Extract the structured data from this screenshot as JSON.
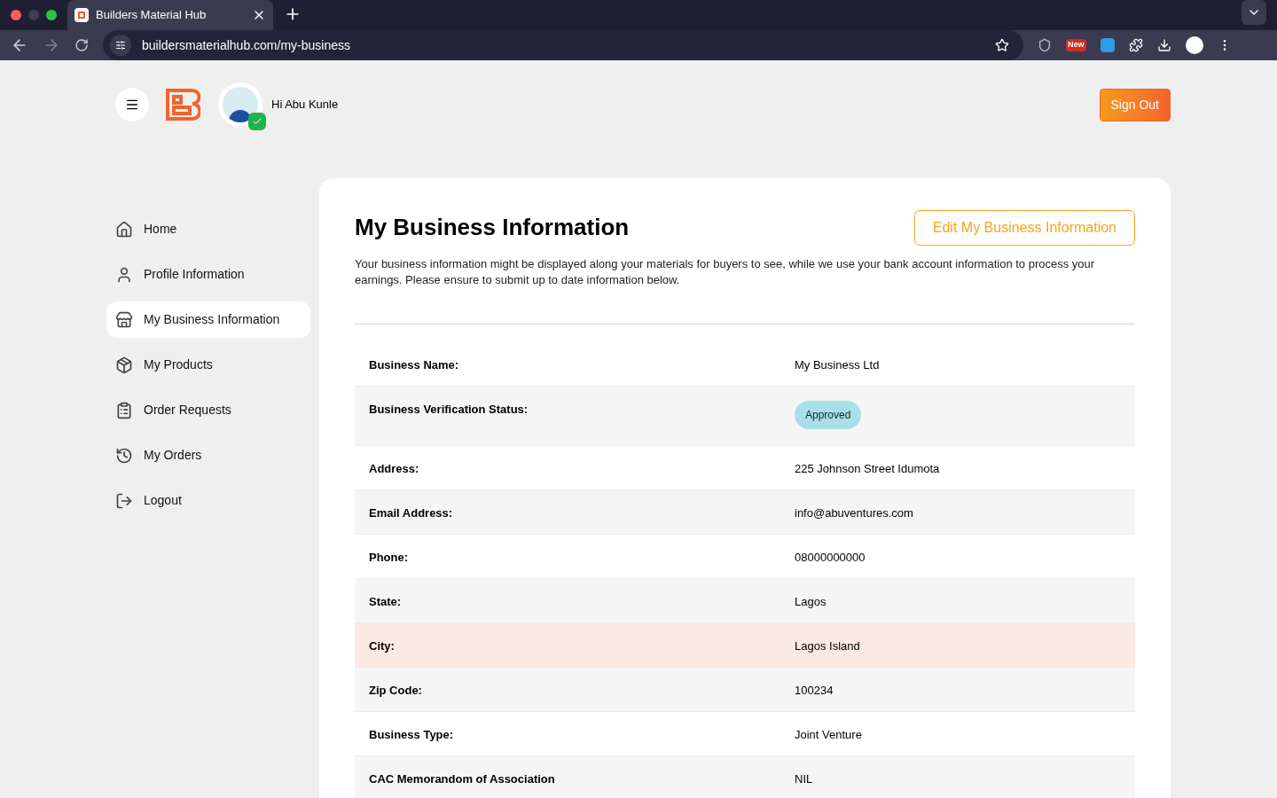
{
  "browser": {
    "tab_title": "Builders Material Hub",
    "url": "buildersmaterialhub.com/my-business",
    "extension_badge": "New"
  },
  "header": {
    "greeting": "Hi Abu Kunle",
    "verified": true,
    "sign_out": "Sign Out"
  },
  "sidebar": {
    "items": [
      {
        "label": "Home",
        "selected": false
      },
      {
        "label": "Profile Information",
        "selected": false
      },
      {
        "label": "My Business Information",
        "selected": true
      },
      {
        "label": "My Products",
        "selected": false
      },
      {
        "label": "Order Requests",
        "selected": false
      },
      {
        "label": "My Orders",
        "selected": false
      },
      {
        "label": "Logout",
        "selected": false
      }
    ]
  },
  "main": {
    "title": "My Business Information",
    "edit_button": "Edit My Business Information",
    "description": "Your business information might be displayed along your materials for buyers to see, while we use your bank account information to process your earnings. Please ensure to submit up to date information below.",
    "rows": [
      {
        "label": "Business Name:",
        "value": "My Business Ltd",
        "kind": "text",
        "highlighted": false
      },
      {
        "label": "Business Verification Status:",
        "value": "Approved",
        "kind": "badge",
        "highlighted": false
      },
      {
        "label": "Address:",
        "value": "225 Johnson Street Idumota",
        "kind": "text",
        "highlighted": false
      },
      {
        "label": "Email Address:",
        "value": "info@abuventures.com",
        "kind": "text",
        "highlighted": false
      },
      {
        "label": "Phone:",
        "value": "08000000000",
        "kind": "text",
        "highlighted": false
      },
      {
        "label": "State:",
        "value": "Lagos",
        "kind": "text",
        "highlighted": false
      },
      {
        "label": "City:",
        "value": "Lagos Island",
        "kind": "text",
        "highlighted": true
      },
      {
        "label": "Zip Code:",
        "value": "100234",
        "kind": "text",
        "highlighted": false
      },
      {
        "label": "Business Type:",
        "value": "Joint Venture",
        "kind": "text",
        "highlighted": false
      },
      {
        "label": "CAC Memorandom of Association",
        "value": "NIL",
        "kind": "text",
        "highlighted": false
      }
    ]
  }
}
